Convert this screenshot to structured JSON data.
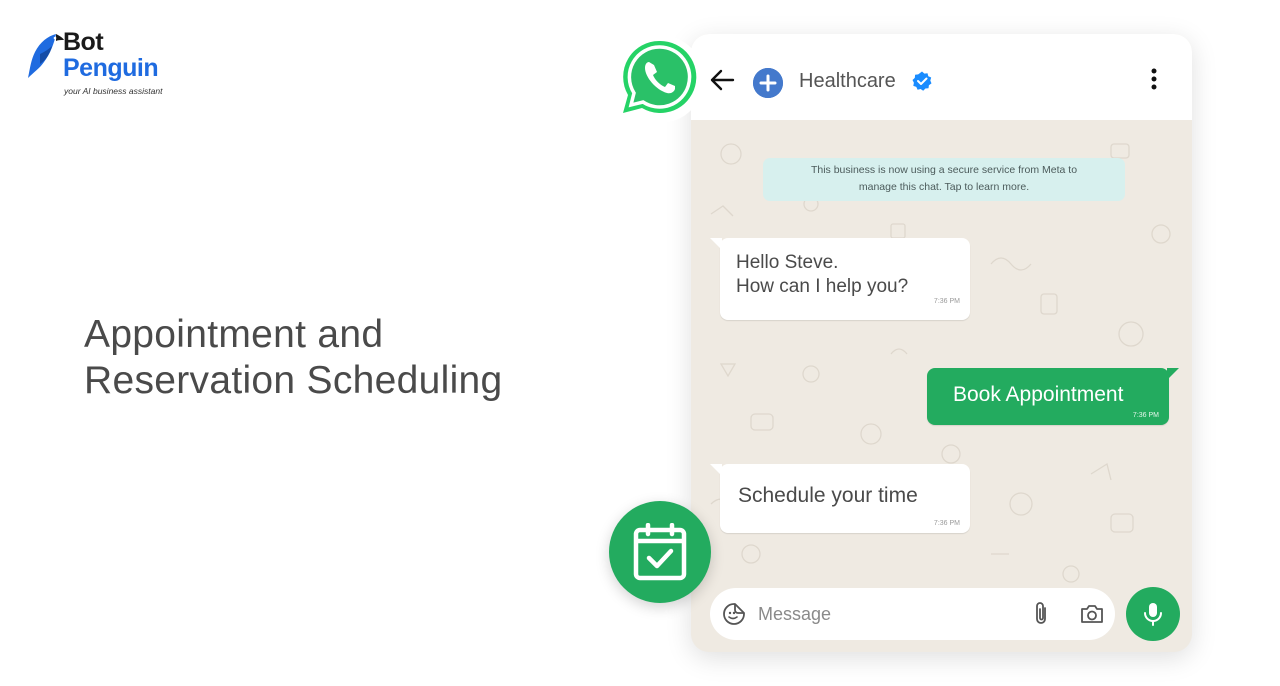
{
  "brand": {
    "name_line1": "Bot",
    "name_line2": "Penguin",
    "tagline": "your AI business assistant",
    "colors": {
      "primary_blue": "#1f6be0",
      "dark": "#1a1a1a"
    }
  },
  "heading": {
    "line1": "Appointment and",
    "line2": "Reservation Scheduling"
  },
  "chat": {
    "header": {
      "contact_name": "Healthcare",
      "verified": true,
      "icons": [
        "back-arrow-icon",
        "medical-plus-icon",
        "verified-badge-icon",
        "more-vertical-icon"
      ]
    },
    "notice": {
      "line1": "This business is now using a secure service from Meta to",
      "line2": "manage this chat. Tap to learn more."
    },
    "messages": [
      {
        "direction": "incoming",
        "line1": "Hello Steve.",
        "line2": "How can I help you?",
        "time": "7:36 PM"
      },
      {
        "direction": "outgoing",
        "text": "Book Appointment",
        "time": "7:36 PM"
      },
      {
        "direction": "incoming",
        "text": "Schedule your time",
        "time": "7:36 PM"
      }
    ],
    "input": {
      "placeholder": "Message",
      "value": "",
      "icons": [
        "sticker-icon",
        "attach-icon",
        "camera-icon",
        "mic-icon"
      ]
    },
    "colors": {
      "accent_green": "#23ab5f",
      "wallpaper": "#efeae2",
      "notice_bg": "#d7f0ee"
    }
  },
  "badges": {
    "whatsapp": "whatsapp-icon",
    "calendar": "calendar-check-icon"
  }
}
